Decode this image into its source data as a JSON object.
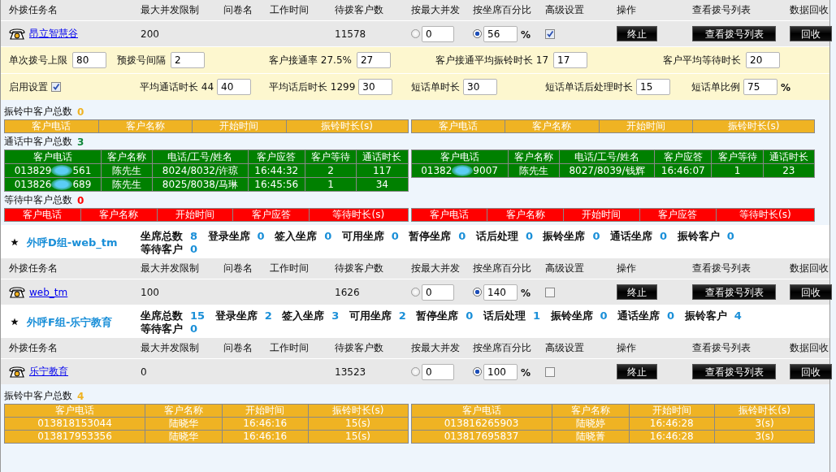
{
  "blocks": [
    {
      "columns": [
        "外拨任务名",
        "最大并发限制",
        "问卷名",
        "工作时间",
        "待拨客户数",
        "按最大并发",
        "按坐席百分比",
        "高级设置",
        "操作",
        "查看拨号列表",
        "数据回收"
      ],
      "task": {
        "name": "昂立智慧谷",
        "max_concurrency": "200",
        "waiting": "11578",
        "by_max": {
          "selected": false,
          "value": "0"
        },
        "by_percent": {
          "selected": true,
          "value": "56",
          "unit": "%"
        },
        "advanced": {
          "checked": true
        },
        "buttons": [
          "终止",
          "查看拨号列表",
          "回收"
        ]
      },
      "settings": [
        [
          {
            "kind": "field",
            "label": "单次拨号上限",
            "value": "80"
          },
          {
            "kind": "field",
            "label": "预拨号间隔",
            "value": "2"
          },
          {
            "kind": "field",
            "label": "客户接通率 27.5%",
            "value": "27"
          },
          {
            "kind": "field",
            "label": "客户接通平均振铃时长 17",
            "value": "17"
          },
          {
            "kind": "field",
            "label": "客户平均等待时长",
            "value": "20"
          }
        ],
        [
          {
            "kind": "checkbox",
            "label": "启用设置",
            "checked": true
          },
          {
            "kind": "field",
            "label": "平均通话时长 44",
            "value": "40"
          },
          {
            "kind": "field",
            "label": "平均话后时长 1299",
            "value": "30"
          },
          {
            "kind": "field",
            "label": "短话单时长",
            "value": "30"
          },
          {
            "kind": "field",
            "label": "短话单话后处理时长",
            "value": "15"
          },
          {
            "kind": "field",
            "label": "短话单比例",
            "value": "75",
            "unit": "%"
          }
        ]
      ],
      "monitor": [
        {
          "kind": "ringing",
          "label": "振铃中客户总数",
          "count": "0",
          "tables": [
            {
              "columns": [
                "客户电话",
                "客户名称",
                "开始时间",
                "振铃时长(s)"
              ]
            },
            {
              "columns": [
                "客户电话",
                "客户名称",
                "开始时间",
                "振铃时长(s)"
              ]
            }
          ]
        },
        {
          "kind": "talking",
          "label": "通话中客户总数",
          "count": "3",
          "tables": [
            {
              "columns": [
                "客户电话",
                "客户名称",
                "电话/工号/姓名",
                "客户应答",
                "客户等待",
                "通话时长"
              ],
              "rows": [
                {
                  "cells": [
                    {
                      "start": "013829",
                      "end": "561"
                    },
                    "陈先生",
                    "8024/8032/许琼",
                    "16:44:32",
                    "2",
                    "117"
                  ]
                },
                {
                  "cells": [
                    {
                      "start": "013826",
                      "end": "689"
                    },
                    "陈先生",
                    "8025/8038/马琳",
                    "16:45:56",
                    "1",
                    "34"
                  ]
                }
              ]
            },
            {
              "columns": [
                "客户电话",
                "客户名称",
                "电话/工号/姓名",
                "客户应答",
                "客户等待",
                "通话时长"
              ],
              "rows": [
                {
                  "cells": [
                    {
                      "start": "01382",
                      "end": "9007"
                    },
                    "陈先生",
                    "8027/8039/钱辉",
                    "16:46:07",
                    "1",
                    "23"
                  ]
                }
              ]
            }
          ]
        },
        {
          "kind": "waiting",
          "label": "等待中客户总数",
          "count": "0",
          "tables": [
            {
              "columns": [
                "客户电话",
                "客户名称",
                "开始时间",
                "客户应答",
                "等待时长(s)"
              ]
            },
            {
              "columns": [
                "客户电话",
                "客户名称",
                "开始时间",
                "客户应答",
                "等待时长(s)"
              ]
            }
          ]
        }
      ]
    },
    {
      "group": {
        "title": "外呼D组-web_tm",
        "stats": [
          {
            "label": "坐席总数",
            "value": "8"
          },
          {
            "label": "登录坐席",
            "value": "0"
          },
          {
            "label": "签入坐席",
            "value": "0"
          },
          {
            "label": "可用坐席",
            "value": "0"
          },
          {
            "label": "暂停坐席",
            "value": "0"
          },
          {
            "label": "话后处理",
            "value": "0"
          },
          {
            "label": "振铃坐席",
            "value": "0"
          },
          {
            "label": "通话坐席",
            "value": "0"
          },
          {
            "label": "振铃客户",
            "value": "0"
          },
          {
            "label": "等待客户",
            "value": "0"
          }
        ]
      },
      "columns": [
        "外拨任务名",
        "最大并发限制",
        "问卷名",
        "工作时间",
        "待拨客户数",
        "按最大并发",
        "按坐席百分比",
        "高级设置",
        "操作",
        "查看拨号列表",
        "数据回收"
      ],
      "task": {
        "name": "web_tm",
        "max_concurrency": "100",
        "waiting": "1626",
        "by_max": {
          "selected": false,
          "value": "0"
        },
        "by_percent": {
          "selected": true,
          "value": "140",
          "unit": "%"
        },
        "advanced": {
          "checked": false
        },
        "buttons": [
          "终止",
          "查看拨号列表",
          "回收"
        ]
      }
    },
    {
      "group": {
        "title": "外呼F组-乐宁教育",
        "stats": [
          {
            "label": "坐席总数",
            "value": "15"
          },
          {
            "label": "登录坐席",
            "value": "2"
          },
          {
            "label": "签入坐席",
            "value": "3"
          },
          {
            "label": "可用坐席",
            "value": "2"
          },
          {
            "label": "暂停坐席",
            "value": "0"
          },
          {
            "label": "话后处理",
            "value": "1"
          },
          {
            "label": "振铃坐席",
            "value": "0"
          },
          {
            "label": "通话坐席",
            "value": "0"
          },
          {
            "label": "振铃客户",
            "value": "4"
          },
          {
            "label": "等待客户",
            "value": "0"
          }
        ]
      },
      "columns": [
        "外拨任务名",
        "最大并发限制",
        "问卷名",
        "工作时间",
        "待拨客户数",
        "按最大并发",
        "按坐席百分比",
        "高级设置",
        "操作",
        "查看拨号列表",
        "数据回收"
      ],
      "task": {
        "name": "乐宁教育",
        "max_concurrency": "0",
        "waiting": "13523",
        "by_max": {
          "selected": false,
          "value": "0"
        },
        "by_percent": {
          "selected": true,
          "value": "100",
          "unit": "%"
        },
        "advanced": {
          "checked": false
        },
        "buttons": [
          "终止",
          "查看拨号列表",
          "回收"
        ]
      },
      "monitor": [
        {
          "kind": "ringing",
          "label": "振铃中客户总数",
          "count": "4",
          "tables": [
            {
              "columns": [
                "客户电话",
                "客户名称",
                "开始时间",
                "振铃时长(s)"
              ],
              "rows": [
                {
                  "cells": [
                    "013818153044",
                    "陆晓华",
                    "16:46:16",
                    "15(s)"
                  ]
                },
                {
                  "cells": [
                    "013817953356",
                    "陆晓华",
                    "16:46:16",
                    "15(s)"
                  ]
                }
              ]
            },
            {
              "columns": [
                "客户电话",
                "客户名称",
                "开始时间",
                "振铃时长(s)"
              ],
              "rows": [
                {
                  "cells": [
                    "013816265903",
                    "陆晓婷",
                    "16:46:28",
                    "3(s)"
                  ]
                },
                {
                  "cells": [
                    "013817695837",
                    "陆晓菁",
                    "16:46:28",
                    "3(s)"
                  ]
                }
              ]
            }
          ]
        }
      ]
    }
  ]
}
